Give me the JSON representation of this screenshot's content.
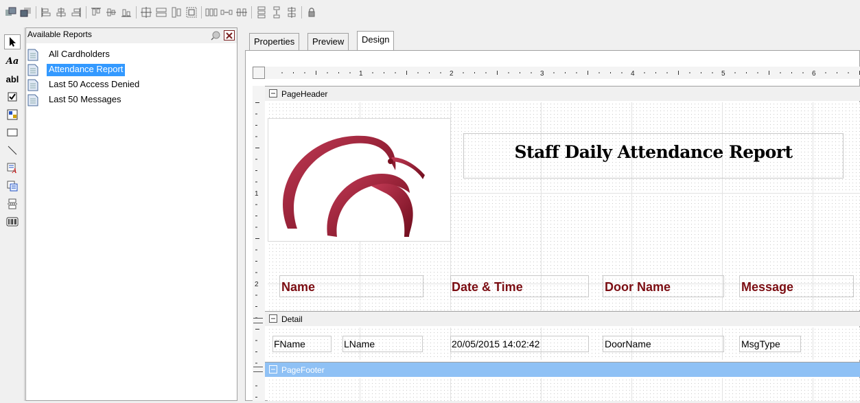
{
  "panel": {
    "title": "Available Reports",
    "reports": [
      {
        "label": "All Cardholders",
        "selected": false
      },
      {
        "label": "Attendance Report",
        "selected": true
      },
      {
        "label": "Last 50 Access Denied",
        "selected": false
      },
      {
        "label": "Last 50 Messages",
        "selected": false
      }
    ]
  },
  "tools": {
    "text_tool_label": "Aa",
    "textbox_tool_label": "abl"
  },
  "tabs": [
    "Properties",
    "Preview",
    "Design"
  ],
  "active_tab": "Design",
  "ruler": {
    "top_numbers": [
      "1",
      "2",
      "3",
      "4",
      "5",
      "6"
    ],
    "left_numbers": [
      "1",
      "2"
    ]
  },
  "bands": {
    "page_header": "PageHeader",
    "detail": "Detail",
    "page_footer": "PageFooter"
  },
  "report": {
    "title": "Staff Daily Attendance Report",
    "columns": [
      "Name",
      "Date & Time",
      "Door Name",
      "Message"
    ],
    "detail_fields": [
      "FName",
      "LName",
      "20/05/2015 14:02:42",
      "DoorName",
      "MsgType"
    ]
  },
  "colors": {
    "column_header": "#7b0d12",
    "logo": "#8b1a2b",
    "selection": "#3399ff",
    "footer_band": "#8fc1f5"
  }
}
